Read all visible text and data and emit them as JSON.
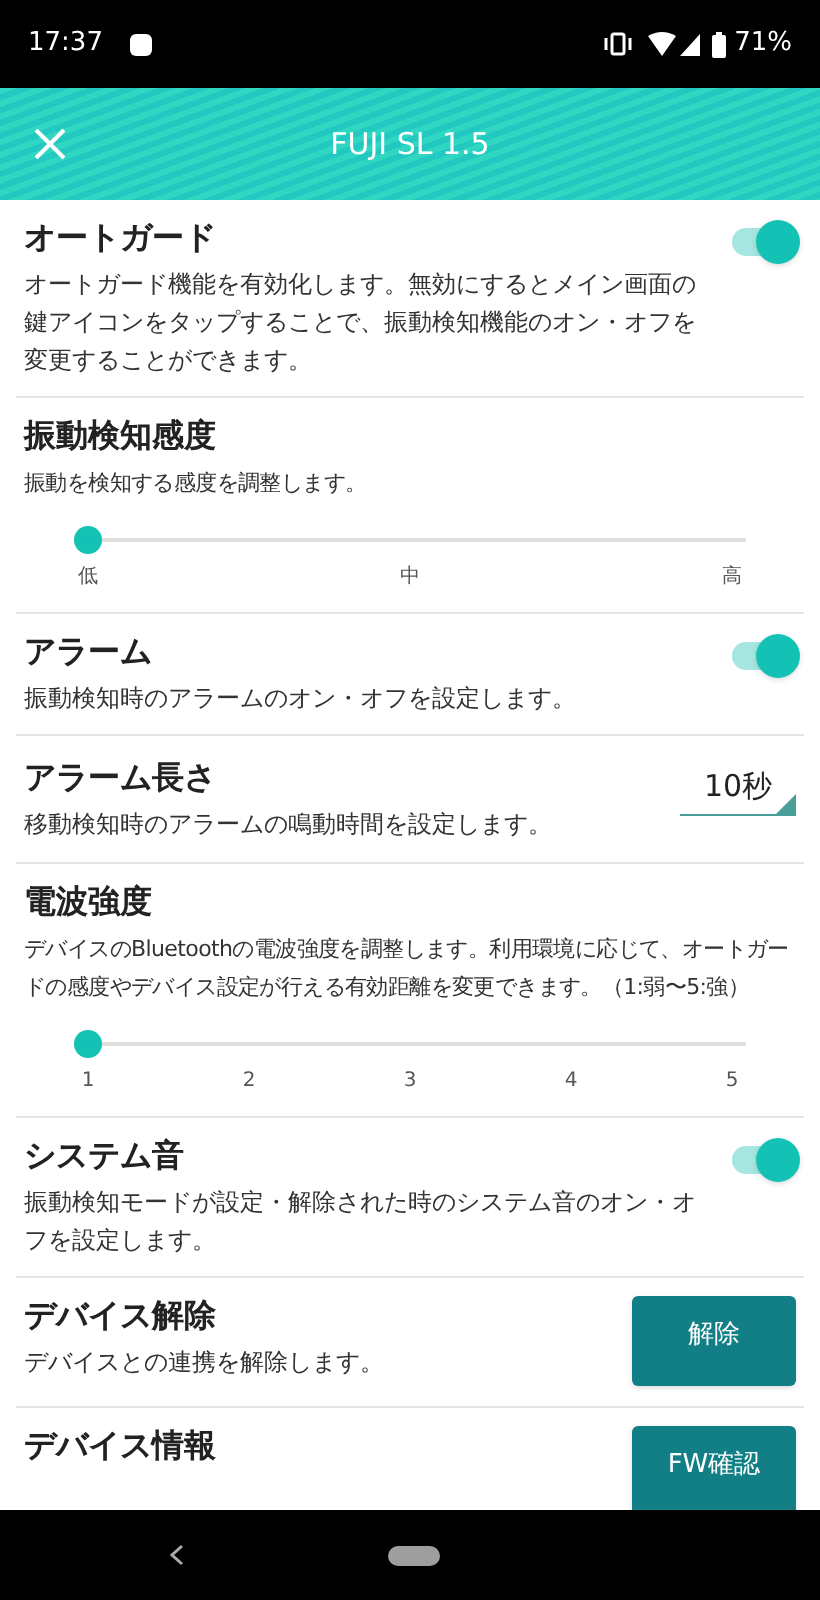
{
  "status_bar": {
    "time": "17:37",
    "battery": "71%"
  },
  "header": {
    "title": "FUJI SL 1.5"
  },
  "settings": [
    {
      "kind": "toggle",
      "title": "オートガード",
      "description": "オートガード機能を有効化します。無効にするとメイン画面の鍵アイコンをタップすることで、振動検知機能のオン・オフを変更することができます。",
      "on": true
    },
    {
      "kind": "slider",
      "title": "振動検知感度",
      "description": "振動を検知する感度を調整します。",
      "level": 0,
      "ticks": [
        "低",
        "中",
        "高"
      ]
    },
    {
      "kind": "toggle",
      "title": "アラーム",
      "description": "振動検知時のアラームのオン・オフを設定します。",
      "on": true
    },
    {
      "kind": "select",
      "title": "アラーム長さ",
      "description": "移動検知時のアラームの鳴動時間を設定します。",
      "value": "10秒"
    },
    {
      "kind": "slider",
      "title": "電波強度",
      "description": "デバイスのBluetoothの電波強度を調整します。利用環境に応じて、オートガードの感度やデバイス設定が行える有効距離を変更できます。（1:弱〜5:強）",
      "level": 0,
      "ticks": [
        "1",
        "2",
        "3",
        "4",
        "5"
      ]
    },
    {
      "kind": "toggle",
      "title": "システム音",
      "description": "振動検知モードが設定・解除された時のシステム音のオン・オフを設定します。",
      "on": true
    },
    {
      "kind": "button",
      "title": "デバイス解除",
      "description": "デバイスとの連携を解除します。",
      "button": "解除"
    },
    {
      "kind": "button",
      "title": "デバイス情報",
      "button": "FW確認"
    }
  ]
}
